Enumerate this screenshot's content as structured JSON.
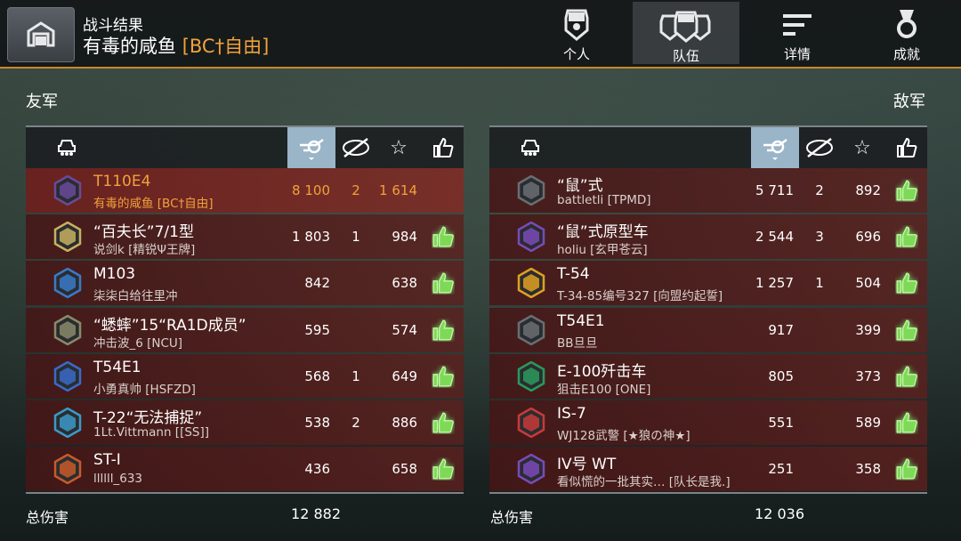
{
  "header": {
    "subtitle": "战斗结果",
    "player_name": "有毒的咸鱼",
    "clan_tag": "[BC†自由]"
  },
  "tabs": [
    {
      "label": "个人",
      "icon": "shield-person-icon",
      "active": false
    },
    {
      "label": "队伍",
      "icon": "team-icon",
      "active": true
    },
    {
      "label": "详情",
      "icon": "details-lines-icon",
      "active": false
    },
    {
      "label": "成就",
      "icon": "medal-icon",
      "active": false
    }
  ],
  "allies": {
    "title": "友军",
    "total_label": "总伤害",
    "total_damage": "12 882",
    "rows": [
      {
        "tank": "T110E4",
        "player": "有毒的咸鱼 [BC†自由]",
        "damage": "8 100",
        "kills": "2",
        "xp": "1 614",
        "me": true,
        "liked": false,
        "badge_color": "#6a4a9a"
      },
      {
        "tank": "“百夫长”7/1型",
        "player": "说剑k [精锐Ψ王牌]",
        "damage": "1 803",
        "kills": "1",
        "xp": "984",
        "me": false,
        "liked": true,
        "badge_color": "#c8b060"
      },
      {
        "tank": "M103",
        "player": "柒柒白给往里冲",
        "damage": "842",
        "kills": "",
        "xp": "638",
        "me": false,
        "liked": true,
        "badge_color": "#3a7ac8"
      },
      {
        "tank": "“蟋蟀”15“RA1D成员”",
        "player": "冲击波_6 [NCU]",
        "damage": "595",
        "kills": "",
        "xp": "574",
        "me": false,
        "liked": true,
        "badge_color": "#8a8a6a"
      },
      {
        "tank": "T54E1",
        "player": "小勇真帅 [HSFZD]",
        "damage": "568",
        "kills": "1",
        "xp": "649",
        "me": false,
        "liked": true,
        "badge_color": "#3a6ac8"
      },
      {
        "tank": "T-22“无法捕捉”",
        "player": "1Lt.Vittmann [[SS]]",
        "damage": "538",
        "kills": "2",
        "xp": "886",
        "me": false,
        "liked": true,
        "badge_color": "#3a9ac8"
      },
      {
        "tank": "ST-I",
        "player": "llllll_633",
        "damage": "436",
        "kills": "",
        "xp": "658",
        "me": false,
        "liked": true,
        "badge_color": "#c85a2a"
      }
    ]
  },
  "enemies": {
    "title": "敌军",
    "total_label": "总伤害",
    "total_damage": "12 036",
    "rows": [
      {
        "tank": "“鼠”式",
        "player": "battletli [TPMD]",
        "damage": "5 711",
        "kills": "2",
        "xp": "892",
        "me": false,
        "liked": true,
        "badge_color": "#6a6e72"
      },
      {
        "tank": "“鼠”式原型车",
        "player": "holiu [玄甲苍云]",
        "damage": "2 544",
        "kills": "3",
        "xp": "696",
        "me": false,
        "liked": true,
        "badge_color": "#7a4ab8"
      },
      {
        "tank": "T-54",
        "player": "T-34-85编号327 [向盟约起誓]",
        "damage": "1 257",
        "kills": "1",
        "xp": "504",
        "me": false,
        "liked": true,
        "badge_color": "#e0a020"
      },
      {
        "tank": "T54E1",
        "player": "BB旦旦",
        "damage": "917",
        "kills": "",
        "xp": "399",
        "me": false,
        "liked": true,
        "badge_color": "#6a6e72"
      },
      {
        "tank": "E-100歼击车",
        "player": "狙击E100 [ONE]",
        "damage": "805",
        "kills": "",
        "xp": "373",
        "me": false,
        "liked": true,
        "badge_color": "#2a9a5a"
      },
      {
        "tank": "IS-7",
        "player": "WJ128武警 [★狼の神★]",
        "damage": "551",
        "kills": "",
        "xp": "589",
        "me": false,
        "liked": true,
        "badge_color": "#c83a3a"
      },
      {
        "tank": "IV号 WT",
        "player": "看似慌的一批其实…   [队长是我.]",
        "damage": "251",
        "kills": "",
        "xp": "358",
        "me": false,
        "liked": true,
        "badge_color": "#7a4ab8"
      }
    ]
  },
  "column_icons": [
    "tank-icon",
    "damage-icon",
    "kills-icon",
    "star-icon",
    "thumbs-up-icon"
  ]
}
